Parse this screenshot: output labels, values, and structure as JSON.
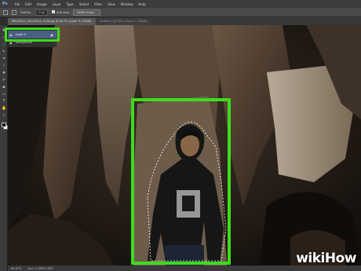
{
  "app": {
    "logo": "Ps"
  },
  "menubar": [
    "File",
    "Edit",
    "Image",
    "Layer",
    "Type",
    "Select",
    "Filter",
    "View",
    "Window",
    "Help"
  ],
  "options": {
    "feather_label": "Feather:",
    "feather_value": "0 px",
    "antialias_label": "Anti-alias",
    "refine_label": "Refine Edge..."
  },
  "tabs": [
    {
      "label": "IMG00011_20130524_1158.jpg @ 66.7% (Layer 0, RGB/8)"
    },
    {
      "label": "Untitled-1 @ 50% (Layer 1, RGB/8)"
    }
  ],
  "layers": {
    "active": "Layer 0",
    "second": "Background"
  },
  "status": {
    "zoom": "66.67%",
    "doc": "Doc: 5.49M/5.49M"
  },
  "watermark": {
    "part1": "wiki",
    "part2": "How"
  },
  "colors": {
    "highlight": "#3ddc1e",
    "selected_layer": "#4a5f82"
  }
}
